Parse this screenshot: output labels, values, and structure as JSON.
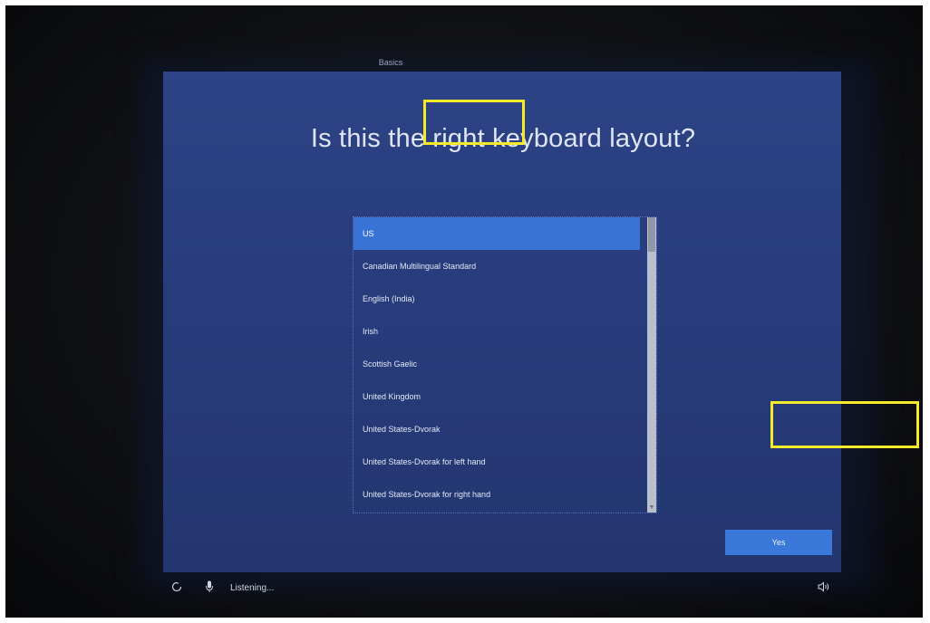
{
  "tab": {
    "label": "Basics"
  },
  "heading": "Is this the right keyboard layout?",
  "layouts": [
    "US",
    "Canadian Multilingual Standard",
    "English (India)",
    "Irish",
    "Scottish Gaelic",
    "United Kingdom",
    "United States-Dvorak",
    "United States-Dvorak for left hand",
    "United States-Dvorak for right hand"
  ],
  "selected_layout": "US",
  "yes_button": "Yes",
  "status": {
    "listening": "Listening..."
  },
  "icons": {
    "ease_of_access": "ease-of-access-icon",
    "microphone": "microphone-icon",
    "volume": "volume-icon"
  },
  "colors": {
    "panel": "#2d4385",
    "selection": "#3a73d6",
    "button": "#3a79d9",
    "highlight": "#f5ea2a"
  }
}
